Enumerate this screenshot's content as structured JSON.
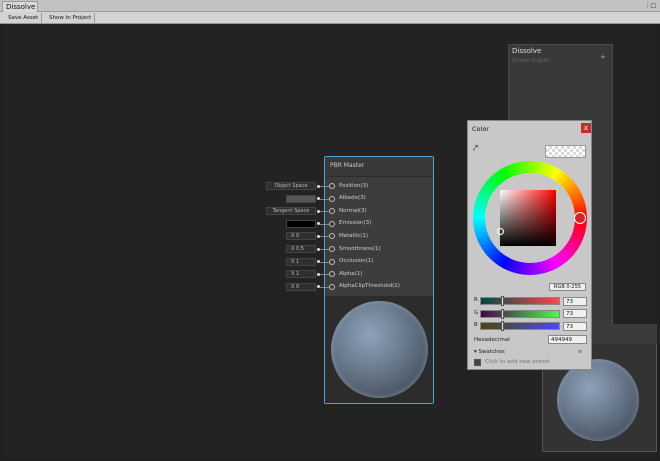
{
  "tab": {
    "title": "Dissolve"
  },
  "toolbar": {
    "save_asset": "Save Asset",
    "show_in_project": "Show In Project"
  },
  "blackboard": {
    "title": "Dissolve",
    "subtitle": "Shader Graphs",
    "add": "+"
  },
  "master_node": {
    "title": "PBR Master",
    "ports": [
      {
        "label": "Position(3)",
        "field": "Object Space"
      },
      {
        "label": "Albedo(3)",
        "field": ""
      },
      {
        "label": "Normal(3)",
        "field": "Tangent Space"
      },
      {
        "label": "Emission(3)",
        "field": ""
      },
      {
        "label": "Metallic(1)",
        "field": "X 0"
      },
      {
        "label": "Smoothness(1)",
        "field": "X 0.5"
      },
      {
        "label": "Occlusion(1)",
        "field": "X 1"
      },
      {
        "label": "Alpha(1)",
        "field": "X 1"
      },
      {
        "label": "AlphaClipThreshold(1)",
        "field": "X 0"
      }
    ]
  },
  "color_picker": {
    "title": "Color",
    "close": "x",
    "mode": "RGB 0-255",
    "channels": [
      {
        "label": "R",
        "value": "73",
        "gradient": "linear-gradient(to right,#004949,#ff4949)",
        "pos": 0.286
      },
      {
        "label": "G",
        "value": "73",
        "gradient": "linear-gradient(to right,#490049,#49ff49)",
        "pos": 0.286
      },
      {
        "label": "B",
        "value": "73",
        "gradient": "linear-gradient(to right,#494900,#4949ff)",
        "pos": 0.286
      }
    ],
    "hex_label": "Hexadecimal",
    "hex_value": "494949",
    "swatches_label": "▾ Swatches",
    "swatches_menu": "≡",
    "preset_text": "Click to add new preset"
  }
}
